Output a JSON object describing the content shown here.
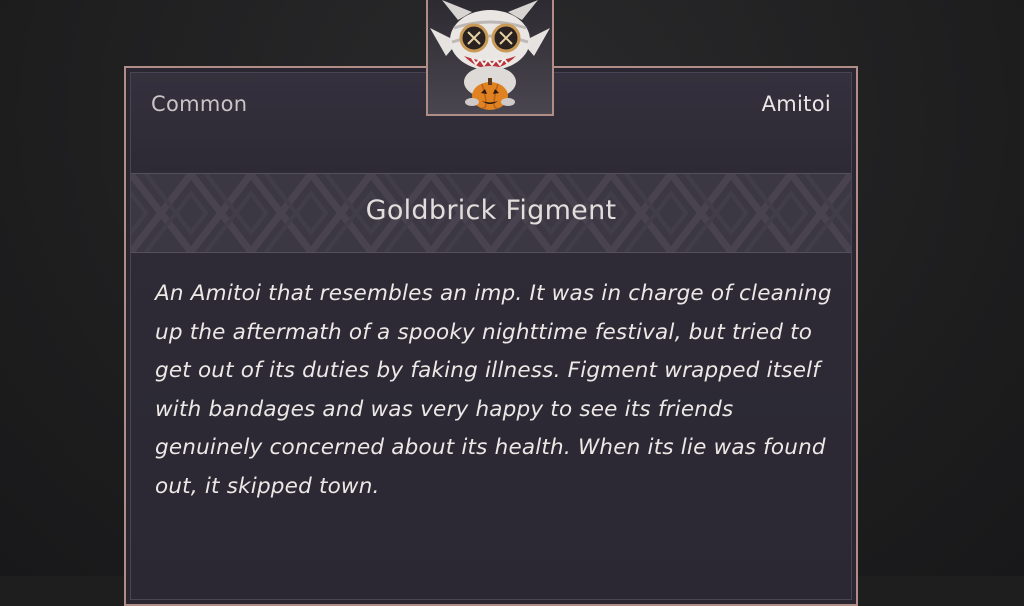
{
  "item": {
    "rarity": "Common",
    "category": "Amitoi",
    "name": "Goldbrick Figment",
    "description": "An Amitoi that resembles an imp. It was in charge of cleaning up the aftermath of a spooky nighttime festival, but tried to get out of its duties by faking illness. Figment wrapped itself with bandages and was very happy to see its friends genuinely concerned about its health. When its lie was found out, it skipped town.",
    "portrait_icon": "amitoi-imp-portrait-icon"
  },
  "colors": {
    "card_border": "#b08d86",
    "card_background": "#2a2733",
    "title_band": "#3c3843",
    "text_primary": "#ece8e6",
    "text_muted": "#c9c4c6"
  }
}
